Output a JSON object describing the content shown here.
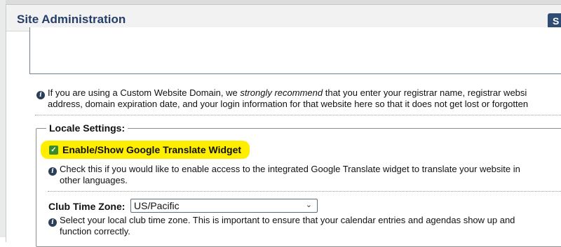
{
  "dialog": {
    "title": "Site Administration",
    "header_button": "S"
  },
  "domain_info": {
    "line1_pre": "If you are using a Custom Website Domain, we ",
    "line1_em": "strongly recommend",
    "line1_post": " that you enter your registrar name, registrar websi",
    "line2": "address, domain expiration date, and your login information for that website here so that it does not get lost or forgotten"
  },
  "locale": {
    "legend": "Locale Settings:",
    "translate": {
      "label": "Enable/Show Google Translate Widget",
      "checked": true,
      "help_line1": "Check this if you would like to enable access to the integrated Google Translate widget to translate your website in",
      "help_line2": "other languages."
    },
    "timezone": {
      "label": "Club Time Zone:",
      "value": "US/Pacific",
      "help_line1": "Select your local club time zone. This is important to ensure that your calendar entries and agendas show up and",
      "help_line2": "function correctly."
    }
  },
  "colors": {
    "title": "#243e68",
    "highlight": "#ffee00",
    "checkbox": "#3c8b2a"
  },
  "icons": {
    "info": "info-icon",
    "check": "checkmark-icon",
    "chevron": "chevron-down-icon"
  }
}
